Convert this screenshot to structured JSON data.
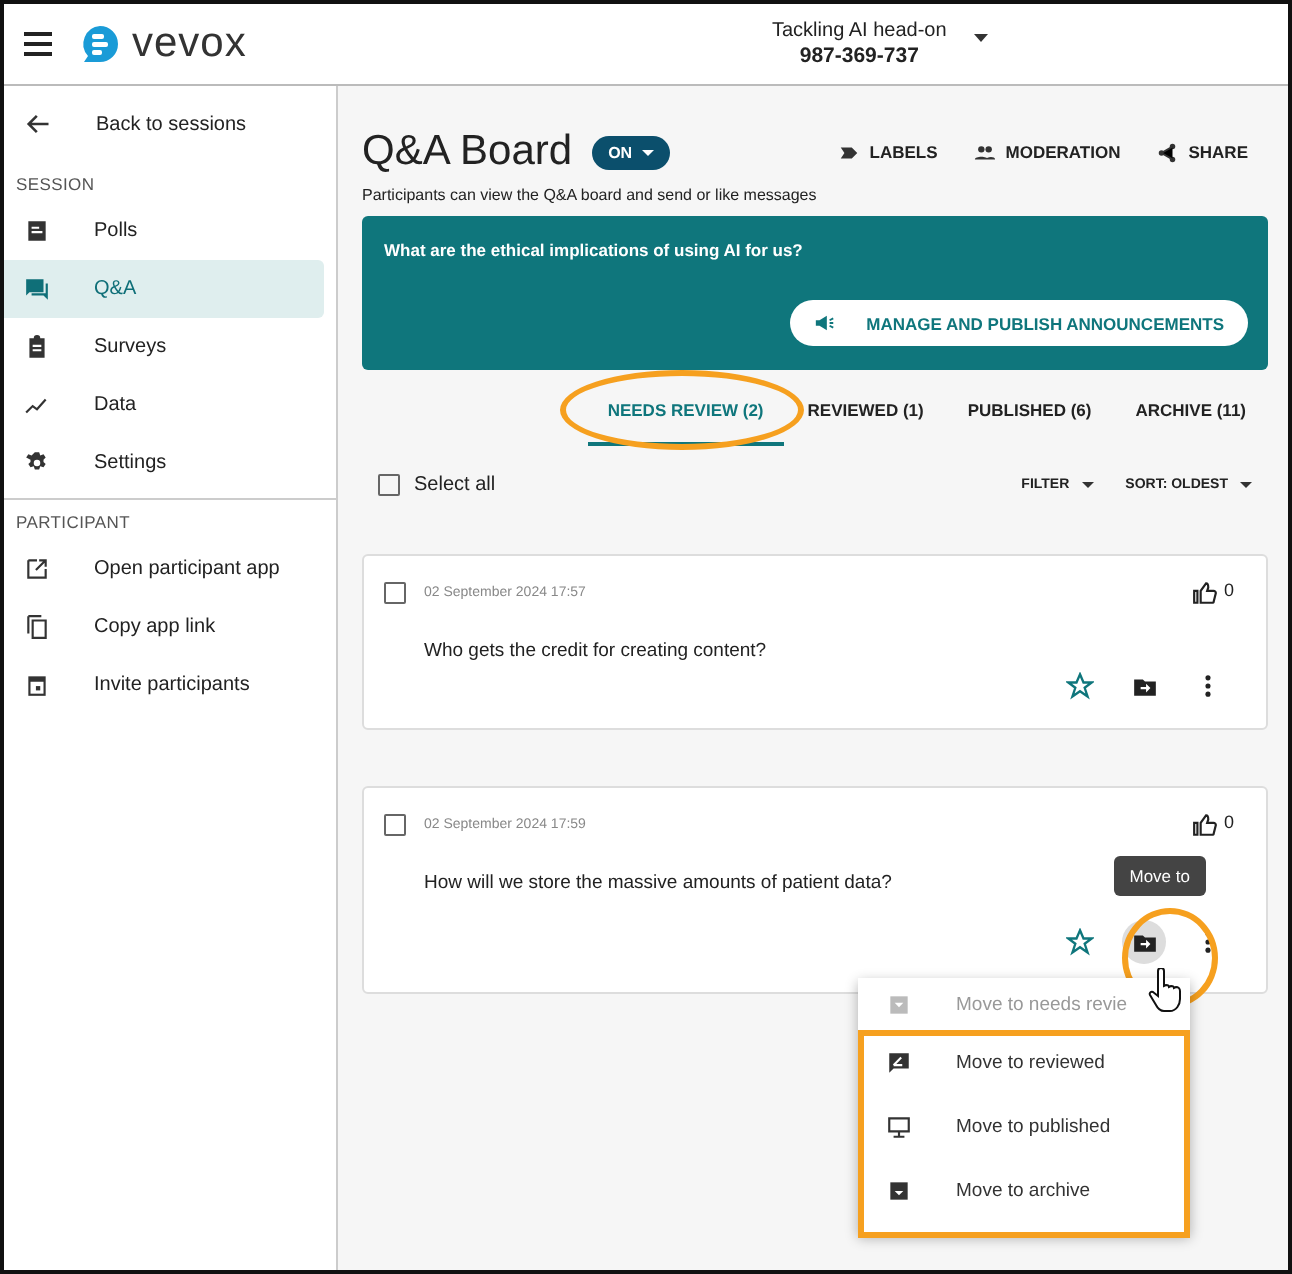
{
  "header": {
    "logo": "vevox",
    "session_title": "Tackling AI head-on",
    "session_code": "987-369-737"
  },
  "sidebar": {
    "back": "Back to sessions",
    "sections": [
      {
        "heading": "SESSION",
        "items": [
          {
            "label": "Polls",
            "selected": false
          },
          {
            "label": "Q&A",
            "selected": true
          },
          {
            "label": "Surveys",
            "selected": false
          },
          {
            "label": "Data",
            "selected": false
          },
          {
            "label": "Settings",
            "selected": false
          }
        ]
      },
      {
        "heading": "PARTICIPANT",
        "items": [
          {
            "label": "Open participant app",
            "selected": false
          },
          {
            "label": "Copy app link",
            "selected": false
          },
          {
            "label": "Invite participants",
            "selected": false
          }
        ]
      }
    ]
  },
  "board": {
    "title": "Q&A Board",
    "status": "ON",
    "actions": [
      "LABELS",
      "MODERATION",
      "SHARE"
    ],
    "description": "Participants can view the Q&A board and send or like messages",
    "announcement": {
      "text": "What are the ethical implications of using AI for us?",
      "button": "MANAGE AND PUBLISH ANNOUNCEMENTS"
    },
    "tabs": [
      {
        "label": "NEEDS REVIEW (2)",
        "selected": true,
        "highlighted": true
      },
      {
        "label": "REVIEWED (1)",
        "selected": false,
        "highlighted": false
      },
      {
        "label": "PUBLISHED (6)",
        "selected": false,
        "highlighted": false
      },
      {
        "label": "ARCHIVE (11)",
        "selected": false,
        "highlighted": false
      }
    ],
    "select_all": {
      "label": "Select all",
      "checked": false
    },
    "filter": "FILTER",
    "sort": "SORT: OLDEST",
    "messages": [
      {
        "date": "02 September 2024 17:57",
        "text": "Who gets the credit for creating content?",
        "likes": "0",
        "checked": false,
        "starred": false,
        "move_hovered": false
      },
      {
        "date": "02 September 2024 17:59",
        "text": "How will we store the massive amounts of patient data?",
        "likes": "0",
        "checked": false,
        "starred": false,
        "move_hovered": true,
        "tooltip": "Move to",
        "menu": {
          "highlighted": true,
          "items": [
            {
              "label": "Move to needs revie",
              "disabled": true
            },
            {
              "label": "Move to reviewed",
              "disabled": false
            },
            {
              "label": "Move to published",
              "disabled": false
            },
            {
              "label": "Move to archive",
              "disabled": false
            }
          ]
        }
      }
    ]
  }
}
